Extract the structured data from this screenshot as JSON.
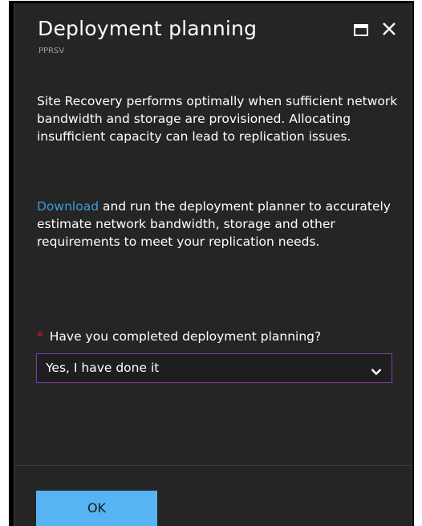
{
  "blade": {
    "title": "Deployment planning",
    "subtitle": "PPRSV",
    "paragraph1": "Site Recovery performs optimally when sufficient network bandwidth and storage are provisioned. Allocating insufficient capacity can lead to replication issues.",
    "paragraph2_link": "Download",
    "paragraph2_rest": " and run the deployment planner to accurately estimate network bandwidth, storage and other requirements to meet your replication needs.",
    "question": {
      "required_marker": "*",
      "label": "Have you completed deployment planning?"
    },
    "dropdown": {
      "selected": "Yes, I have done it"
    },
    "ok_label": "OK"
  },
  "icons": {
    "maximize": "maximize-icon",
    "close": "close-icon",
    "dropdown": "chevron-down-icon"
  },
  "colors": {
    "background": "#252526",
    "link": "#3b9bdf",
    "required": "#e81123",
    "dropdown_border": "#7b3fa8",
    "ok_button": "#57b4f2"
  }
}
